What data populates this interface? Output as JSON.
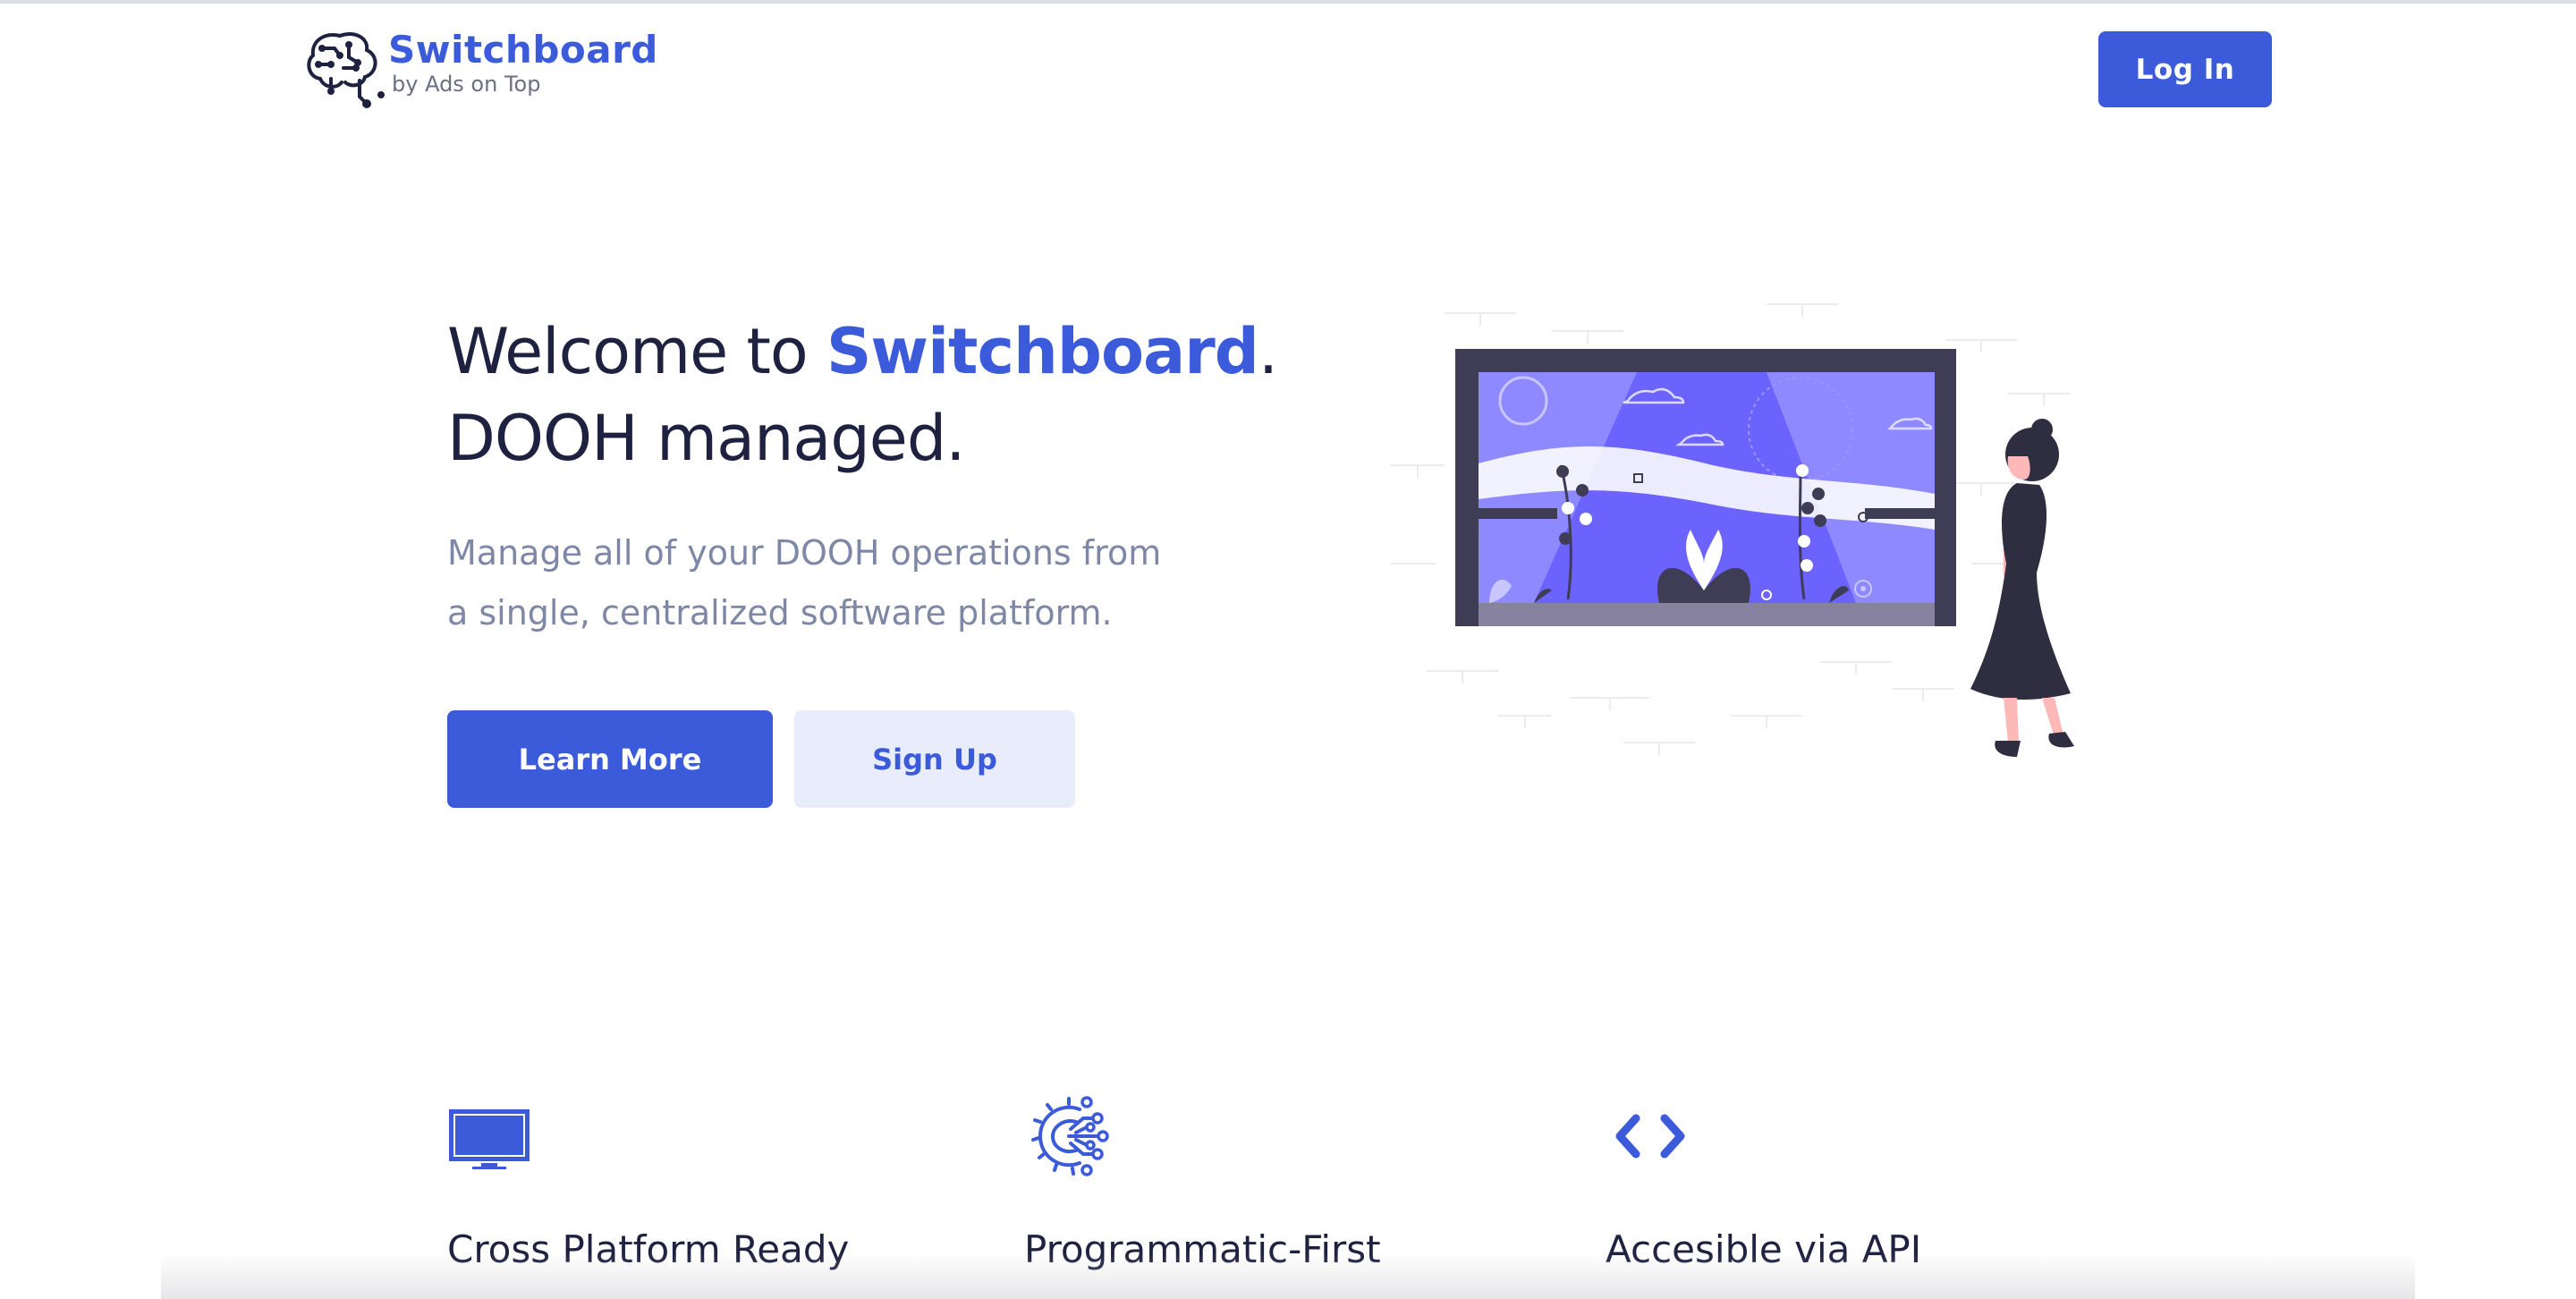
{
  "header": {
    "logo_title": "Switchboard",
    "logo_subtitle": "by Ads on Top",
    "login_label": "Log In"
  },
  "hero": {
    "title_prefix": "Welcome to ",
    "title_brand": "Switchboard",
    "title_suffix": ".",
    "title_line2": "DOOH managed.",
    "subtitle": "Manage all of your DOOH operations from a single, centralized software platform.",
    "learn_more_label": "Learn More",
    "sign_up_label": "Sign Up"
  },
  "features": [
    {
      "icon": "monitor-icon",
      "label": "Cross Platform Ready"
    },
    {
      "icon": "gear-circuit-icon",
      "label": "Programmatic-First"
    },
    {
      "icon": "code-brackets-icon",
      "label": "Accesible via API"
    }
  ],
  "colors": {
    "accent": "#3b5bdb",
    "secondary_button_bg": "#e9edfb",
    "text_dark": "#1e2140",
    "text_muted": "#7e88a6",
    "illustration_purple": "#6c63ff",
    "illustration_frame": "#3f3d56"
  }
}
